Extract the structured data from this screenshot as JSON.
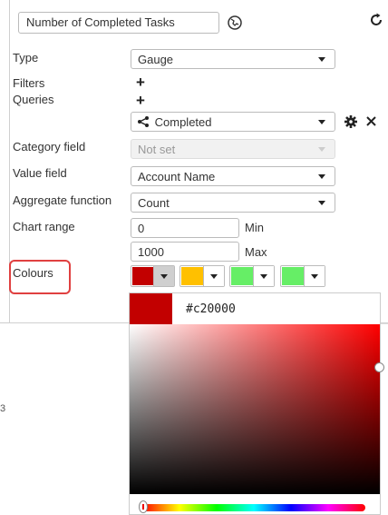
{
  "header": {
    "title_value": "Number of Completed Tasks"
  },
  "form": {
    "type": {
      "label": "Type",
      "value": "Gauge"
    },
    "filters": {
      "label": "Filters",
      "add": "+"
    },
    "queries": {
      "label": "Queries",
      "add": "+",
      "item": "Completed"
    },
    "category_field": {
      "label": "Category field",
      "value": "Not set"
    },
    "value_field": {
      "label": "Value field",
      "value": "Account Name"
    },
    "aggregate_function": {
      "label": "Aggregate function",
      "value": "Count"
    },
    "chart_range": {
      "label": "Chart range",
      "min_value": "0",
      "min_label": "Min",
      "max_value": "1000",
      "max_label": "Max"
    },
    "colours": {
      "label": "Colours",
      "swatches": [
        "#c20000",
        "#ffc000",
        "#66ee66",
        "#66ee66"
      ]
    }
  },
  "color_picker": {
    "hex": "#c20000",
    "hue_color": "#ff0000"
  },
  "side_mark": "3"
}
